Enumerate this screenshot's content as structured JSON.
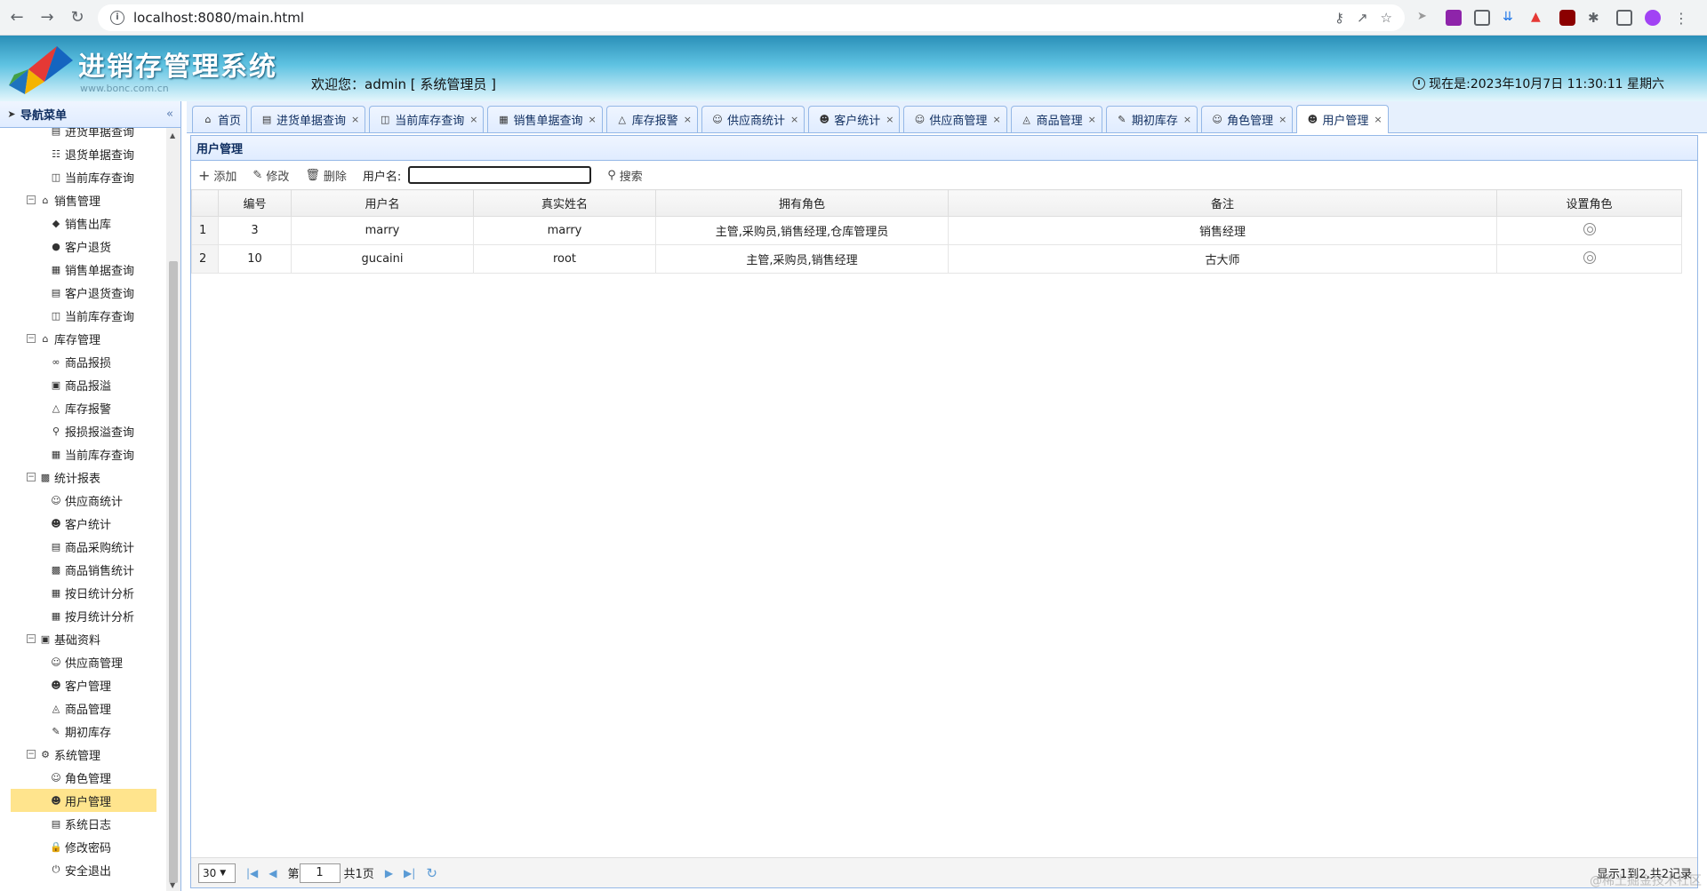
{
  "browser": {
    "url": "localhost:8080/main.html"
  },
  "header": {
    "title": "进销存管理系统",
    "subtitle": "www.bonc.com.cn",
    "welcome": "欢迎您：admin [ 系统管理员 ]",
    "clock": "现在是:2023年10月7日 11:30:11 星期六"
  },
  "sidebar": {
    "title": "导航菜单",
    "collapse": "«",
    "tree": [
      {
        "type": "leaf",
        "label": "进货单据查询",
        "icon": "document-icon"
      },
      {
        "type": "leaf",
        "label": "退货单据查询",
        "icon": "list-icon"
      },
      {
        "type": "leaf",
        "label": "当前库存查询",
        "icon": "inventory-icon"
      },
      {
        "type": "group",
        "label": "销售管理",
        "icon": "cart-icon"
      },
      {
        "type": "leaf",
        "label": "销售出库",
        "icon": "tag-icon"
      },
      {
        "type": "leaf",
        "label": "客户退货",
        "icon": "return-icon"
      },
      {
        "type": "leaf",
        "label": "销售单据查询",
        "icon": "receipt-icon"
      },
      {
        "type": "leaf",
        "label": "客户退货查询",
        "icon": "document-icon"
      },
      {
        "type": "leaf",
        "label": "当前库存查询",
        "icon": "inventory-icon"
      },
      {
        "type": "group",
        "label": "库存管理",
        "icon": "home-icon"
      },
      {
        "type": "leaf",
        "label": "商品报损",
        "icon": "damage-icon"
      },
      {
        "type": "leaf",
        "label": "商品报溢",
        "icon": "overflow-icon"
      },
      {
        "type": "leaf",
        "label": "库存报警",
        "icon": "warning-icon"
      },
      {
        "type": "leaf",
        "label": "报损报溢查询",
        "icon": "search-icon"
      },
      {
        "type": "leaf",
        "label": "当前库存查询",
        "icon": "grid-icon"
      },
      {
        "type": "group",
        "label": "统计报表",
        "icon": "chart-icon"
      },
      {
        "type": "leaf",
        "label": "供应商统计",
        "icon": "user-icon"
      },
      {
        "type": "leaf",
        "label": "客户统计",
        "icon": "users-icon"
      },
      {
        "type": "leaf",
        "label": "商品采购统计",
        "icon": "document-icon"
      },
      {
        "type": "leaf",
        "label": "商品销售统计",
        "icon": "bar-chart-icon"
      },
      {
        "type": "leaf",
        "label": "按日统计分析",
        "icon": "calendar-icon"
      },
      {
        "type": "leaf",
        "label": "按月统计分析",
        "icon": "calendar-icon"
      },
      {
        "type": "group",
        "label": "基础资料",
        "icon": "book-icon"
      },
      {
        "type": "leaf",
        "label": "供应商管理",
        "icon": "user-icon"
      },
      {
        "type": "leaf",
        "label": "客户管理",
        "icon": "users-icon"
      },
      {
        "type": "leaf",
        "label": "商品管理",
        "icon": "box-icon"
      },
      {
        "type": "leaf",
        "label": "期初库存",
        "icon": "edit-icon"
      },
      {
        "type": "group",
        "label": "系统管理",
        "icon": "gear-icon"
      },
      {
        "type": "leaf",
        "label": "角色管理",
        "icon": "role-icon"
      },
      {
        "type": "leaf",
        "label": "用户管理",
        "icon": "user-admin-icon",
        "selected": true
      },
      {
        "type": "leaf",
        "label": "系统日志",
        "icon": "log-icon"
      },
      {
        "type": "leaf",
        "label": "修改密码",
        "icon": "lock-icon"
      },
      {
        "type": "leaf",
        "label": "安全退出",
        "icon": "power-icon"
      }
    ]
  },
  "tabs": [
    {
      "label": "首页",
      "icon": "home-icon",
      "closable": false
    },
    {
      "label": "进货单据查询",
      "icon": "document-icon",
      "closable": true
    },
    {
      "label": "当前库存查询",
      "icon": "inventory-icon",
      "closable": true
    },
    {
      "label": "销售单据查询",
      "icon": "receipt-icon",
      "closable": true
    },
    {
      "label": "库存报警",
      "icon": "warning-icon",
      "closable": true
    },
    {
      "label": "供应商统计",
      "icon": "user-icon",
      "closable": true
    },
    {
      "label": "客户统计",
      "icon": "users-icon",
      "closable": true
    },
    {
      "label": "供应商管理",
      "icon": "user-icon",
      "closable": true
    },
    {
      "label": "商品管理",
      "icon": "box-icon",
      "closable": true
    },
    {
      "label": "期初库存",
      "icon": "edit-icon",
      "closable": true
    },
    {
      "label": "角色管理",
      "icon": "role-icon",
      "closable": true
    },
    {
      "label": "用户管理",
      "icon": "user-admin-icon",
      "closable": true,
      "active": true
    }
  ],
  "panel": {
    "title": "用户管理",
    "toolbar": {
      "add": "添加",
      "edit": "修改",
      "delete": "删除",
      "username_label": "用户名:",
      "username_value": "",
      "search": "搜索"
    },
    "table": {
      "columns": [
        "编号",
        "用户名",
        "真实姓名",
        "拥有角色",
        "备注",
        "设置角色"
      ],
      "rows": [
        {
          "rownum": "1",
          "id": "3",
          "username": "marry",
          "realname": "marry",
          "roles": "主管,采购员,销售经理,仓库管理员",
          "remark": "销售经理"
        },
        {
          "rownum": "2",
          "id": "10",
          "username": "gucaini",
          "realname": "root",
          "roles": "主管,采购员,销售经理",
          "remark": "古大师"
        }
      ]
    },
    "pager": {
      "page_size": "30",
      "page_prefix": "第",
      "page_value": "1",
      "page_suffix": "共1页",
      "info": "显示1到2,共2记录",
      "watermark": "@稀土掘金技术社区"
    }
  }
}
